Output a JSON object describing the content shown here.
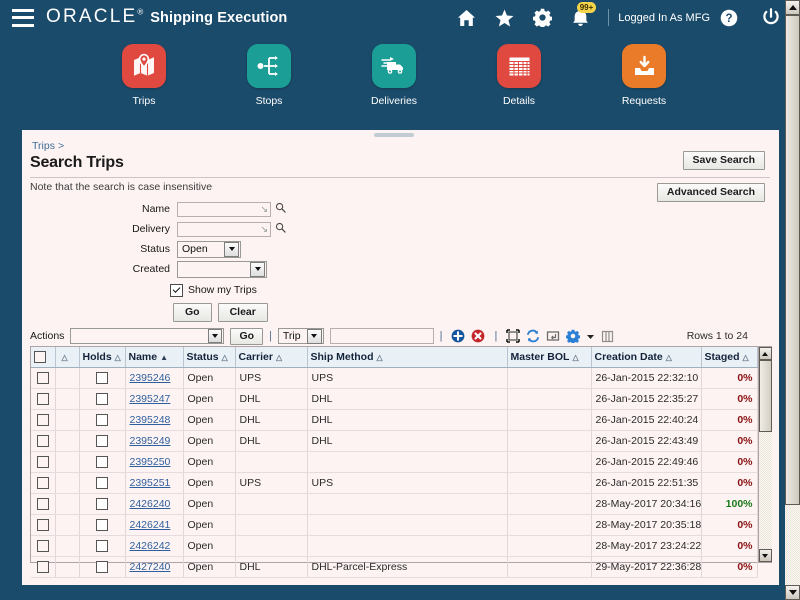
{
  "header": {
    "brand": "ORACLE",
    "brand_mark": "®",
    "app_title": "Shipping Execution",
    "menu_icon": "hamburger-menu-icon",
    "home_icon": "home-icon",
    "favorites_icon": "star-icon",
    "settings_icon": "gear-icon",
    "notifications_icon": "bell-icon",
    "notifications_badge": "99+",
    "help_icon": "help-icon",
    "logout_icon": "power-icon",
    "logged_in_text": "Logged In As MFG",
    "bar_color": "#1b4b6b"
  },
  "iconnav": {
    "items": [
      {
        "label": "Trips",
        "icon": "map-pin-icon",
        "color": "#e0493f",
        "active": true
      },
      {
        "label": "Stops",
        "icon": "route-node-icon",
        "color": "#1b9e96",
        "active": false
      },
      {
        "label": "Deliveries",
        "icon": "truck-icon",
        "color": "#1b9e96",
        "active": false
      },
      {
        "label": "Details",
        "icon": "grid-table-icon",
        "color": "#e0493f",
        "active": false
      },
      {
        "label": "Requests",
        "icon": "inbox-down-icon",
        "color": "#ea7b28",
        "active": false
      }
    ]
  },
  "panel": {
    "breadcrumb": "Trips",
    "breadcrumb_sep": ">",
    "page_title": "Search Trips",
    "note": "Note that the search is case insensitive",
    "save_search_label": "Save Search",
    "advanced_search_label": "Advanced Search"
  },
  "search_form": {
    "fields": [
      {
        "label": "Name",
        "value": "",
        "placeholder": "",
        "type": "lov"
      },
      {
        "label": "Delivery",
        "value": "",
        "placeholder": "",
        "type": "lov"
      },
      {
        "label": "Status",
        "value": "Open",
        "type": "select"
      },
      {
        "label": "Created",
        "value": "",
        "type": "select"
      }
    ],
    "checkbox_label": "Show my Trips",
    "checkbox_checked": true,
    "go_label": "Go",
    "clear_label": "Clear",
    "lov_icon": "lov-arrow-icon",
    "search_icon": "magnifier-icon"
  },
  "actions_bar": {
    "label": "Actions",
    "action_value": "",
    "go_label": "Go",
    "entity_value": "Trip",
    "quick_search_value": "",
    "rows_info": "Rows 1 to 24",
    "icons": [
      {
        "name": "add-row-icon",
        "glyph": "+",
        "color": "#16569d"
      },
      {
        "name": "delete-row-icon",
        "glyph": "×",
        "color": "#c5262b"
      },
      {
        "name": "select-all-icon",
        "glyph": "",
        "color": "#3c3c3c"
      },
      {
        "name": "refresh-icon",
        "glyph": "",
        "color": "#2b7fd4"
      },
      {
        "name": "export-icon",
        "glyph": "",
        "color": "#6d6d6d"
      },
      {
        "name": "settings-gear-icon",
        "glyph": "",
        "color": "#2b7fd4"
      },
      {
        "name": "columns-icon",
        "glyph": "",
        "color": "#8d8d8d"
      }
    ]
  },
  "table": {
    "columns": [
      {
        "key": "select",
        "label": "",
        "sort": "none",
        "align": "center"
      },
      {
        "key": "holds",
        "label": "Holds",
        "sort": "asc2",
        "align": "center"
      },
      {
        "key": "name",
        "label": "Name",
        "sort": "active",
        "align": "left"
      },
      {
        "key": "status",
        "label": "Status",
        "sort": "none",
        "align": "left"
      },
      {
        "key": "carrier",
        "label": "Carrier",
        "sort": "none",
        "align": "left"
      },
      {
        "key": "ship",
        "label": "Ship Method",
        "sort": "none",
        "align": "left"
      },
      {
        "key": "bol",
        "label": "Master BOL",
        "sort": "none",
        "align": "left"
      },
      {
        "key": "created",
        "label": "Creation Date",
        "sort": "none",
        "align": "right"
      },
      {
        "key": "staged",
        "label": "Staged",
        "sort": "none",
        "align": "right"
      }
    ],
    "rows": [
      {
        "name": "2395246",
        "status": "Open",
        "carrier": "UPS",
        "ship": "UPS",
        "bol": "",
        "created": "26-Jan-2015 22:32:10",
        "staged": "0%"
      },
      {
        "name": "2395247",
        "status": "Open",
        "carrier": "DHL",
        "ship": "DHL",
        "bol": "",
        "created": "26-Jan-2015 22:35:27",
        "staged": "0%"
      },
      {
        "name": "2395248",
        "status": "Open",
        "carrier": "DHL",
        "ship": "DHL",
        "bol": "",
        "created": "26-Jan-2015 22:40:24",
        "staged": "0%"
      },
      {
        "name": "2395249",
        "status": "Open",
        "carrier": "DHL",
        "ship": "DHL",
        "bol": "",
        "created": "26-Jan-2015 22:43:49",
        "staged": "0%"
      },
      {
        "name": "2395250",
        "status": "Open",
        "carrier": "",
        "ship": "",
        "bol": "",
        "created": "26-Jan-2015 22:49:46",
        "staged": "0%"
      },
      {
        "name": "2395251",
        "status": "Open",
        "carrier": "UPS",
        "ship": "UPS",
        "bol": "",
        "created": "26-Jan-2015 22:51:35",
        "staged": "0%"
      },
      {
        "name": "2426240",
        "status": "Open",
        "carrier": "",
        "ship": "",
        "bol": "",
        "created": "28-May-2017 20:34:16",
        "staged": "100%"
      },
      {
        "name": "2426241",
        "status": "Open",
        "carrier": "",
        "ship": "",
        "bol": "",
        "created": "28-May-2017 20:35:18",
        "staged": "0%"
      },
      {
        "name": "2426242",
        "status": "Open",
        "carrier": "",
        "ship": "",
        "bol": "",
        "created": "28-May-2017 23:24:22",
        "staged": "0%"
      },
      {
        "name": "2427240",
        "status": "Open",
        "carrier": "DHL",
        "ship": "DHL-Parcel-Express",
        "bol": "",
        "created": "29-May-2017 22:36:28",
        "staged": "0%"
      }
    ]
  },
  "colors": {
    "header_blue": "#1b4b6b",
    "panel_bg": "#fdf3f2",
    "link_blue": "#2d5f9e",
    "header_cell": "#e9f1f7",
    "pct_zero": "#8a1212",
    "pct_full": "#1a7a1a"
  }
}
